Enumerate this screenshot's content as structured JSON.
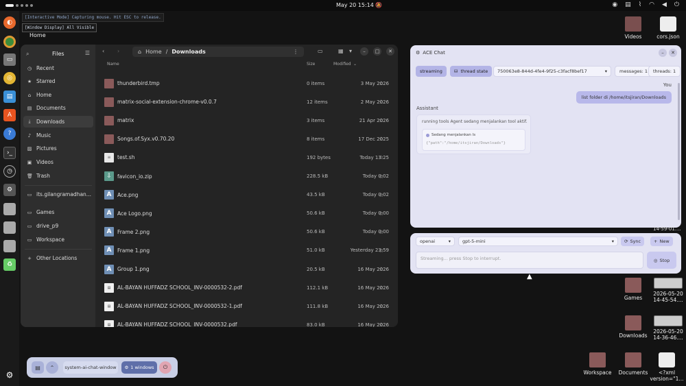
{
  "topbar": {
    "clock": "May 20  15:14"
  },
  "banners": {
    "mode": "[Interactive Mode] Capturing mouse. Hit ESC to release.",
    "window": "[Window Display] All Visible",
    "home": "Home"
  },
  "files": {
    "sidebar_title": "Files",
    "path_root": "Home",
    "path_current": "Downloads",
    "sidebar": [
      {
        "label": "Recent",
        "icon": "clock-icon",
        "glyph": "◷"
      },
      {
        "label": "Starred",
        "icon": "star-icon",
        "glyph": "★"
      },
      {
        "label": "Home",
        "icon": "home-icon",
        "glyph": "⌂"
      },
      {
        "label": "Documents",
        "icon": "document-icon",
        "glyph": "▤"
      },
      {
        "label": "Downloads",
        "icon": "download-icon",
        "glyph": "⤓",
        "active": true
      },
      {
        "label": "Music",
        "icon": "music-icon",
        "glyph": "♪"
      },
      {
        "label": "Pictures",
        "icon": "picture-icon",
        "glyph": "▨"
      },
      {
        "label": "Videos",
        "icon": "video-icon",
        "glyph": "▣"
      },
      {
        "label": "Trash",
        "icon": "trash-icon",
        "glyph": "🗑"
      },
      {
        "label": "its.gilangramadhan...",
        "icon": "drive-icon",
        "glyph": "▭"
      },
      {
        "label": "Games",
        "icon": "folder-icon",
        "glyph": "▭"
      },
      {
        "label": "drive_p9",
        "icon": "folder-icon",
        "glyph": "▭"
      },
      {
        "label": "Workspace",
        "icon": "folder-icon",
        "glyph": "▭"
      },
      {
        "label": "Other Locations",
        "icon": "plus-icon",
        "glyph": "+"
      }
    ],
    "columns": {
      "name": "Name",
      "size": "Size",
      "modified": "Modified"
    },
    "rows": [
      {
        "name": "thunderbird.tmp",
        "size": "0 items",
        "modified": "3 May 2026",
        "type": "folder"
      },
      {
        "name": "matrix-social-extension-chrome-v0.0.7",
        "size": "12 items",
        "modified": "2 May 2026",
        "type": "folder"
      },
      {
        "name": "matrix",
        "size": "3 items",
        "modified": "21 Apr 2026",
        "type": "folder"
      },
      {
        "name": "Songs.of.Syx.v0.70.20",
        "size": "8 items",
        "modified": "17 Dec 2025",
        "type": "folder"
      },
      {
        "name": "test.sh",
        "size": "192 bytes",
        "modified": "Today 13:25",
        "type": "file"
      },
      {
        "name": "favicon_io.zip",
        "size": "228.5 kB",
        "modified": "Today 0:02",
        "type": "zip"
      },
      {
        "name": "Ace.png",
        "size": "43.5 kB",
        "modified": "Today 0:02",
        "type": "png"
      },
      {
        "name": "Ace Logo.png",
        "size": "50.6 kB",
        "modified": "Today 0:00",
        "type": "png"
      },
      {
        "name": "Frame 2.png",
        "size": "50.6 kB",
        "modified": "Today 0:00",
        "type": "png"
      },
      {
        "name": "Frame 1.png",
        "size": "51.0 kB",
        "modified": "Yesterday 23:59",
        "type": "png"
      },
      {
        "name": "Group 1.png",
        "size": "20.5 kB",
        "modified": "16 May 2026",
        "type": "png"
      },
      {
        "name": "AL-BAYAN HUFFADZ SCHOOL_INV-0000532-2.pdf",
        "size": "112.1 kB",
        "modified": "16 May 2026",
        "type": "pdf"
      },
      {
        "name": "AL-BAYAN HUFFADZ SCHOOL_INV-0000532-1.pdf",
        "size": "111.8 kB",
        "modified": "16 May 2026",
        "type": "pdf"
      },
      {
        "name": "AL-BAYAN HUFFADZ SCHOOL_INV-0000532.pdf",
        "size": "83.0 kB",
        "modified": "16 May 2026",
        "type": "pdf"
      }
    ]
  },
  "ace": {
    "title": "ACE Chat",
    "streaming": "streaming",
    "thread_state": "thread state",
    "thread_id": "750063e8-844d-4fe4-9f25-c3facf8bef17",
    "messages": "messages: 1",
    "threads": "threads: 1",
    "you": "You",
    "user_message": "list folder di /home/itsjiran/Downloads",
    "assistant": "Assistant",
    "status": "running tools  Agent sedang menjalankan tool aktif.",
    "tool_name": "Sedang menjalankan ls",
    "tool_args": "{\"path\":\"/home/itsjiran/Downloads\"}",
    "provider": "openai",
    "model": "gpt-5-mini",
    "sync": "Sync",
    "new": "New",
    "input_placeholder": "Streaming... press Stop to interrupt.",
    "stop": "Stop"
  },
  "desktop": {
    "videos": "Videos",
    "cors": "cors.json",
    "games": "Games",
    "downloads": "Downloads",
    "workspace": "Workspace",
    "documents": "Documents",
    "xml": "<?xml version=\"1...",
    "shot1a": "2026-05-20",
    "shot1b": "14-45-54....",
    "shot2a": "2026-05-20",
    "shot2b": "14-36-46....",
    "partial": "14-59-01...."
  },
  "taskbar": {
    "window_name": "system-ai-chat-window",
    "windows": "1 windows"
  }
}
